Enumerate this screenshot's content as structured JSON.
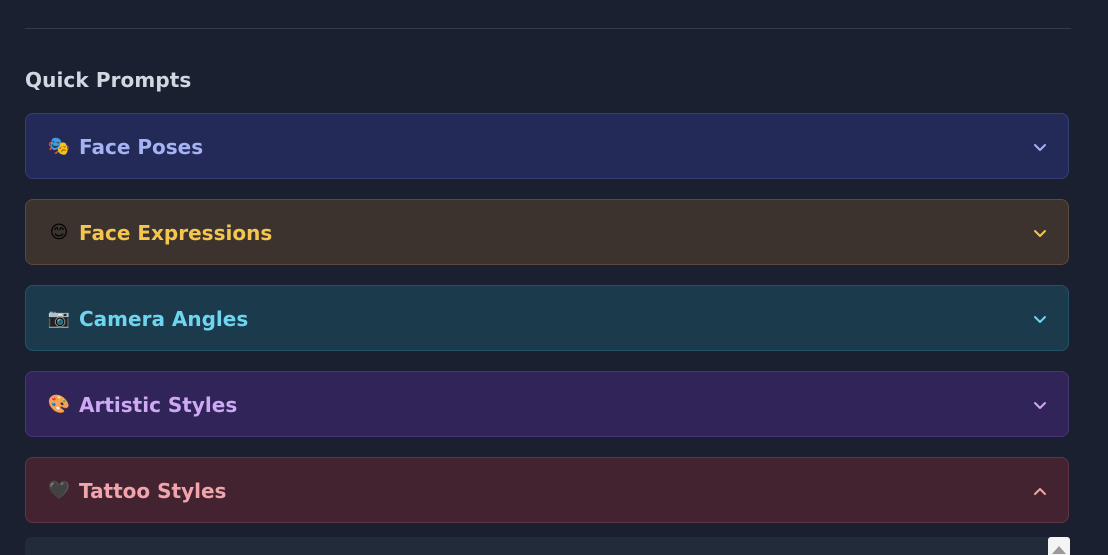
{
  "section": {
    "title": "Quick Prompts"
  },
  "accordions": [
    {
      "emoji": "🎭",
      "label": "Face Poses",
      "state": "collapsed",
      "color": "#a5b3f4"
    },
    {
      "emoji": "😊",
      "label": "Face Expressions",
      "state": "collapsed",
      "color": "#f4c64d"
    },
    {
      "emoji": "📷",
      "label": "Camera Angles",
      "state": "collapsed",
      "color": "#6ed5ef"
    },
    {
      "emoji": "🎨",
      "label": "Artistic Styles",
      "state": "collapsed",
      "color": "#cfa9f4"
    },
    {
      "emoji": "🖤",
      "label": "Tattoo Styles",
      "state": "expanded",
      "color": "#f1a4ac"
    }
  ],
  "icons": {
    "collapsed": "chevron-down-icon",
    "expanded": "chevron-up-icon",
    "scroll": "scroll-up-icon"
  }
}
